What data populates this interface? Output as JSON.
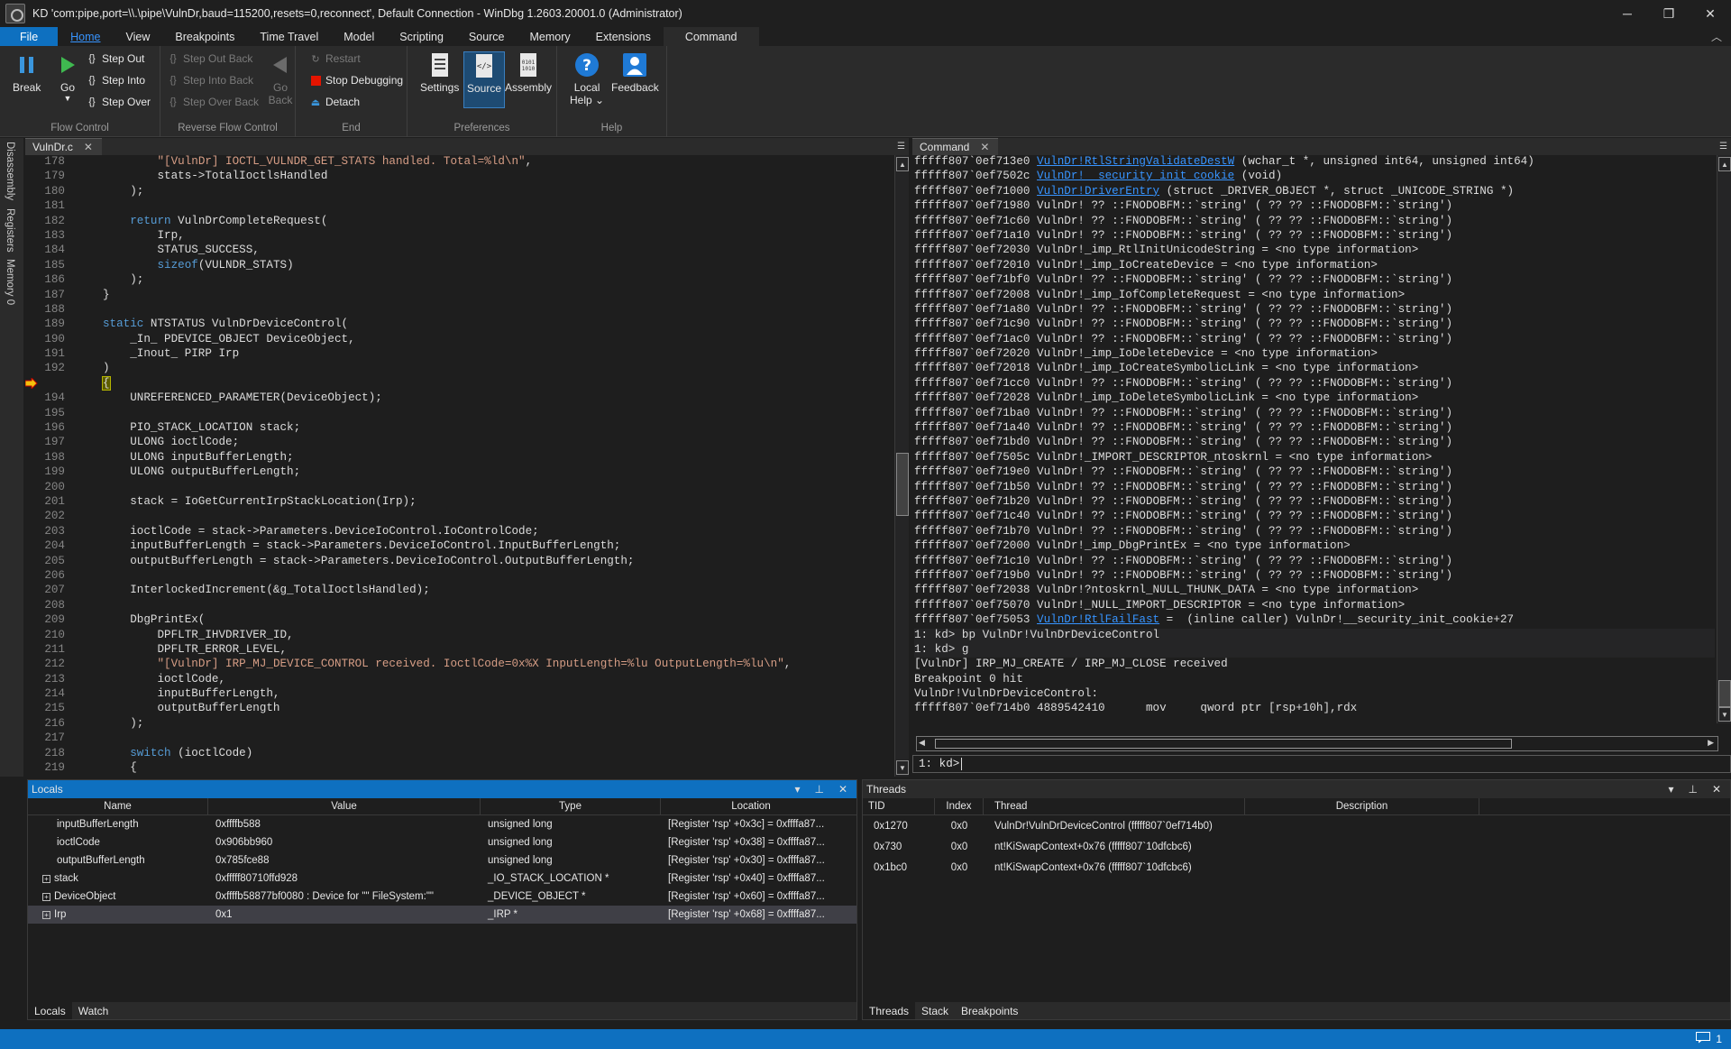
{
  "window": {
    "title": "KD 'com:pipe,port=\\\\.\\pipe\\VulnDr,baud=115200,resets=0,reconnect', Default Connection  - WinDbg 1.2603.20001.0 (Administrator)",
    "minimize": "─",
    "restore": "❐",
    "close": "✕"
  },
  "menu_tabs": [
    "File",
    "Home",
    "View",
    "Breakpoints",
    "Time Travel",
    "Model",
    "Scripting",
    "Source",
    "Memory",
    "Extensions",
    "Command"
  ],
  "ribbon": {
    "break": "Break",
    "go": "Go",
    "step_out": "Step Out",
    "step_into": "Step Into",
    "step_over": "Step Over",
    "flow_control": "Flow Control",
    "step_out_back": "Step Out Back",
    "step_into_back": "Step Into Back",
    "step_over_back": "Step Over Back",
    "go_back_1": "Go",
    "go_back_2": "Back",
    "reverse_flow_control": "Reverse Flow Control",
    "restart": "Restart",
    "stop_debugging": "Stop Debugging",
    "detach": "Detach",
    "end": "End",
    "settings": "Settings",
    "source": "Source",
    "assembly": "Assembly",
    "preferences": "Preferences",
    "local_help_1": "Local",
    "local_help_2": "Help",
    "feedback": "Feedback",
    "help": "Help"
  },
  "side_tabs": [
    "Disassembly",
    "Registers",
    "Memory 0"
  ],
  "source": {
    "tab": "VulnDr.c",
    "lines": [
      {
        "n": "178",
        "t": "        \"[VulnDr] IOCTL_VULNDR_GET_STATS handled. Total=%ld\\n\","
      },
      {
        "n": "179",
        "t": "        stats->TotalIoctlsHandled"
      },
      {
        "n": "180",
        "t": "    );"
      },
      {
        "n": "181",
        "t": ""
      },
      {
        "n": "182",
        "t": "    return VulnDrCompleteRequest("
      },
      {
        "n": "183",
        "t": "        Irp,"
      },
      {
        "n": "184",
        "t": "        STATUS_SUCCESS,"
      },
      {
        "n": "185",
        "t": "        sizeof(VULNDR_STATS)"
      },
      {
        "n": "186",
        "t": "    );"
      },
      {
        "n": "187",
        "t": "}"
      },
      {
        "n": "188",
        "t": ""
      },
      {
        "n": "189",
        "t": "static NTSTATUS VulnDrDeviceControl("
      },
      {
        "n": "190",
        "t": "    _In_ PDEVICE_OBJECT DeviceObject,"
      },
      {
        "n": "191",
        "t": "    _Inout_ PIRP Irp"
      },
      {
        "n": "192",
        "t": ")"
      },
      {
        "n": "193",
        "t": "{"
      },
      {
        "n": "194",
        "t": "    UNREFERENCED_PARAMETER(DeviceObject);"
      },
      {
        "n": "195",
        "t": ""
      },
      {
        "n": "196",
        "t": "    PIO_STACK_LOCATION stack;"
      },
      {
        "n": "197",
        "t": "    ULONG ioctlCode;"
      },
      {
        "n": "198",
        "t": "    ULONG inputBufferLength;"
      },
      {
        "n": "199",
        "t": "    ULONG outputBufferLength;"
      },
      {
        "n": "200",
        "t": ""
      },
      {
        "n": "201",
        "t": "    stack = IoGetCurrentIrpStackLocation(Irp);"
      },
      {
        "n": "202",
        "t": ""
      },
      {
        "n": "203",
        "t": "    ioctlCode = stack->Parameters.DeviceIoControl.IoControlCode;"
      },
      {
        "n": "204",
        "t": "    inputBufferLength = stack->Parameters.DeviceIoControl.InputBufferLength;"
      },
      {
        "n": "205",
        "t": "    outputBufferLength = stack->Parameters.DeviceIoControl.OutputBufferLength;"
      },
      {
        "n": "206",
        "t": ""
      },
      {
        "n": "207",
        "t": "    InterlockedIncrement(&g_TotalIoctlsHandled);"
      },
      {
        "n": "208",
        "t": ""
      },
      {
        "n": "209",
        "t": "    DbgPrintEx("
      },
      {
        "n": "210",
        "t": "        DPFLTR_IHVDRIVER_ID,"
      },
      {
        "n": "211",
        "t": "        DPFLTR_ERROR_LEVEL,"
      },
      {
        "n": "212",
        "t": "        \"[VulnDr] IRP_MJ_DEVICE_CONTROL received. IoctlCode=0x%X InputLength=%lu OutputLength=%lu\\n\","
      },
      {
        "n": "213",
        "t": "        ioctlCode,"
      },
      {
        "n": "214",
        "t": "        inputBufferLength,"
      },
      {
        "n": "215",
        "t": "        outputBufferLength"
      },
      {
        "n": "216",
        "t": "    );"
      },
      {
        "n": "217",
        "t": ""
      },
      {
        "n": "218",
        "t": "    switch (ioctlCode)"
      },
      {
        "n": "219",
        "t": "    {"
      }
    ],
    "current_line": "193"
  },
  "command": {
    "tab": "Command",
    "lines": [
      "fffff807`0ef713e0 VulnDr!RtlStringValidateDestW (wchar_t *, unsigned int64, unsigned int64)",
      "fffff807`0ef7502c VulnDr!__security_init_cookie (void)",
      "fffff807`0ef71000 VulnDr!DriverEntry (struct _DRIVER_OBJECT *, struct _UNICODE_STRING *)",
      "fffff807`0ef71980 VulnDr! ?? ::FNODOBFM::`string' ( ?? ?? ::FNODOBFM::`string')",
      "fffff807`0ef71c60 VulnDr! ?? ::FNODOBFM::`string' ( ?? ?? ::FNODOBFM::`string')",
      "fffff807`0ef71a10 VulnDr! ?? ::FNODOBFM::`string' ( ?? ?? ::FNODOBFM::`string')",
      "fffff807`0ef72030 VulnDr!_imp_RtlInitUnicodeString = <no type information>",
      "fffff807`0ef72010 VulnDr!_imp_IoCreateDevice = <no type information>",
      "fffff807`0ef71bf0 VulnDr! ?? ::FNODOBFM::`string' ( ?? ?? ::FNODOBFM::`string')",
      "fffff807`0ef72008 VulnDr!_imp_IofCompleteRequest = <no type information>",
      "fffff807`0ef71a80 VulnDr! ?? ::FNODOBFM::`string' ( ?? ?? ::FNODOBFM::`string')",
      "fffff807`0ef71c90 VulnDr! ?? ::FNODOBFM::`string' ( ?? ?? ::FNODOBFM::`string')",
      "fffff807`0ef71ac0 VulnDr! ?? ::FNODOBFM::`string' ( ?? ?? ::FNODOBFM::`string')",
      "fffff807`0ef72020 VulnDr!_imp_IoDeleteDevice = <no type information>",
      "fffff807`0ef72018 VulnDr!_imp_IoCreateSymbolicLink = <no type information>",
      "fffff807`0ef71cc0 VulnDr! ?? ::FNODOBFM::`string' ( ?? ?? ::FNODOBFM::`string')",
      "fffff807`0ef72028 VulnDr!_imp_IoDeleteSymbolicLink = <no type information>",
      "fffff807`0ef71ba0 VulnDr! ?? ::FNODOBFM::`string' ( ?? ?? ::FNODOBFM::`string')",
      "fffff807`0ef71a40 VulnDr! ?? ::FNODOBFM::`string' ( ?? ?? ::FNODOBFM::`string')",
      "fffff807`0ef71bd0 VulnDr! ?? ::FNODOBFM::`string' ( ?? ?? ::FNODOBFM::`string')",
      "fffff807`0ef7505c VulnDr!_IMPORT_DESCRIPTOR_ntoskrnl = <no type information>",
      "fffff807`0ef719e0 VulnDr! ?? ::FNODOBFM::`string' ( ?? ?? ::FNODOBFM::`string')",
      "fffff807`0ef71b50 VulnDr! ?? ::FNODOBFM::`string' ( ?? ?? ::FNODOBFM::`string')",
      "fffff807`0ef71b20 VulnDr! ?? ::FNODOBFM::`string' ( ?? ?? ::FNODOBFM::`string')",
      "fffff807`0ef71c40 VulnDr! ?? ::FNODOBFM::`string' ( ?? ?? ::FNODOBFM::`string')",
      "fffff807`0ef71b70 VulnDr! ?? ::FNODOBFM::`string' ( ?? ?? ::FNODOBFM::`string')",
      "fffff807`0ef72000 VulnDr!_imp_DbgPrintEx = <no type information>",
      "fffff807`0ef71c10 VulnDr! ?? ::FNODOBFM::`string' ( ?? ?? ::FNODOBFM::`string')",
      "fffff807`0ef719b0 VulnDr! ?? ::FNODOBFM::`string' ( ?? ?? ::FNODOBFM::`string')",
      "fffff807`0ef72038 VulnDr!?ntoskrnl_NULL_THUNK_DATA = <no type information>",
      "fffff807`0ef75070 VulnDr!_NULL_IMPORT_DESCRIPTOR = <no type information>",
      "fffff807`0ef75053 VulnDr!RtlFailFast =  (inline caller) VulnDr!__security_init_cookie+27",
      "1: kd> bp VulnDr!VulnDrDeviceControl",
      "1: kd> g",
      "[VulnDr] IRP_MJ_CREATE / IRP_MJ_CLOSE received",
      "Breakpoint 0 hit",
      "VulnDr!VulnDrDeviceControl:",
      "fffff807`0ef714b0 4889542410      mov     qword ptr [rsp+10h],rdx"
    ],
    "links": {
      "0": "VulnDr!RtlStringValidateDestW",
      "1": "VulnDr!__security_init_cookie",
      "2": "VulnDr!DriverEntry",
      "31": "VulnDr!RtlFailFast"
    },
    "prompt": "1: kd>"
  },
  "locals": {
    "title": "Locals",
    "columns": [
      "Name",
      "Value",
      "Type",
      "Location"
    ],
    "rows": [
      {
        "name": "inputBufferLength",
        "value": "0xffffb588",
        "type": "unsigned long",
        "location": "[Register 'rsp' +0x3c] = 0xffffa87...",
        "expand": false
      },
      {
        "name": "ioctlCode",
        "value": "0x906bb960",
        "type": "unsigned long",
        "location": "[Register 'rsp' +0x38] = 0xffffa87...",
        "expand": false
      },
      {
        "name": "outputBufferLength",
        "value": "0x785fce88",
        "type": "unsigned long",
        "location": "[Register 'rsp' +0x30] = 0xffffa87...",
        "expand": false
      },
      {
        "name": "stack",
        "value": "0xfffff80710ffd928",
        "type": "_IO_STACK_LOCATION *",
        "location": "[Register 'rsp' +0x40] = 0xffffa87...",
        "expand": true
      },
      {
        "name": "DeviceObject",
        "value": "0xffffb58877bf0080 : Device for \"\" FileSystem:\"\"",
        "type": "_DEVICE_OBJECT *",
        "location": "[Register 'rsp' +0x60] = 0xffffa87...",
        "expand": true
      },
      {
        "name": "Irp",
        "value": "0x1",
        "type": "_IRP *",
        "location": "[Register 'rsp' +0x68] = 0xffffa87...",
        "expand": true
      }
    ],
    "tabs": [
      "Locals",
      "Watch"
    ]
  },
  "threads": {
    "title": "Threads",
    "columns": [
      "TID",
      "Index",
      "Thread",
      "Description"
    ],
    "rows": [
      {
        "tid": "0x1270",
        "index": "0x0",
        "thread": "VulnDr!VulnDrDeviceControl (fffff807`0ef714b0)",
        "desc": ""
      },
      {
        "tid": "0x730",
        "index": "0x0",
        "thread": "nt!KiSwapContext+0x76 (fffff807`10dfcbc6)",
        "desc": ""
      },
      {
        "tid": "0x1bc0",
        "index": "0x0",
        "thread": "nt!KiSwapContext+0x76 (fffff807`10dfcbc6)",
        "desc": ""
      }
    ],
    "tabs": [
      "Threads",
      "Stack",
      "Breakpoints"
    ]
  },
  "status": {
    "notifications": "1"
  },
  "colors": {
    "accent": "#0e70c0",
    "keyword": "#569cd6",
    "string": "#d69d85",
    "link": "#3794ff"
  }
}
